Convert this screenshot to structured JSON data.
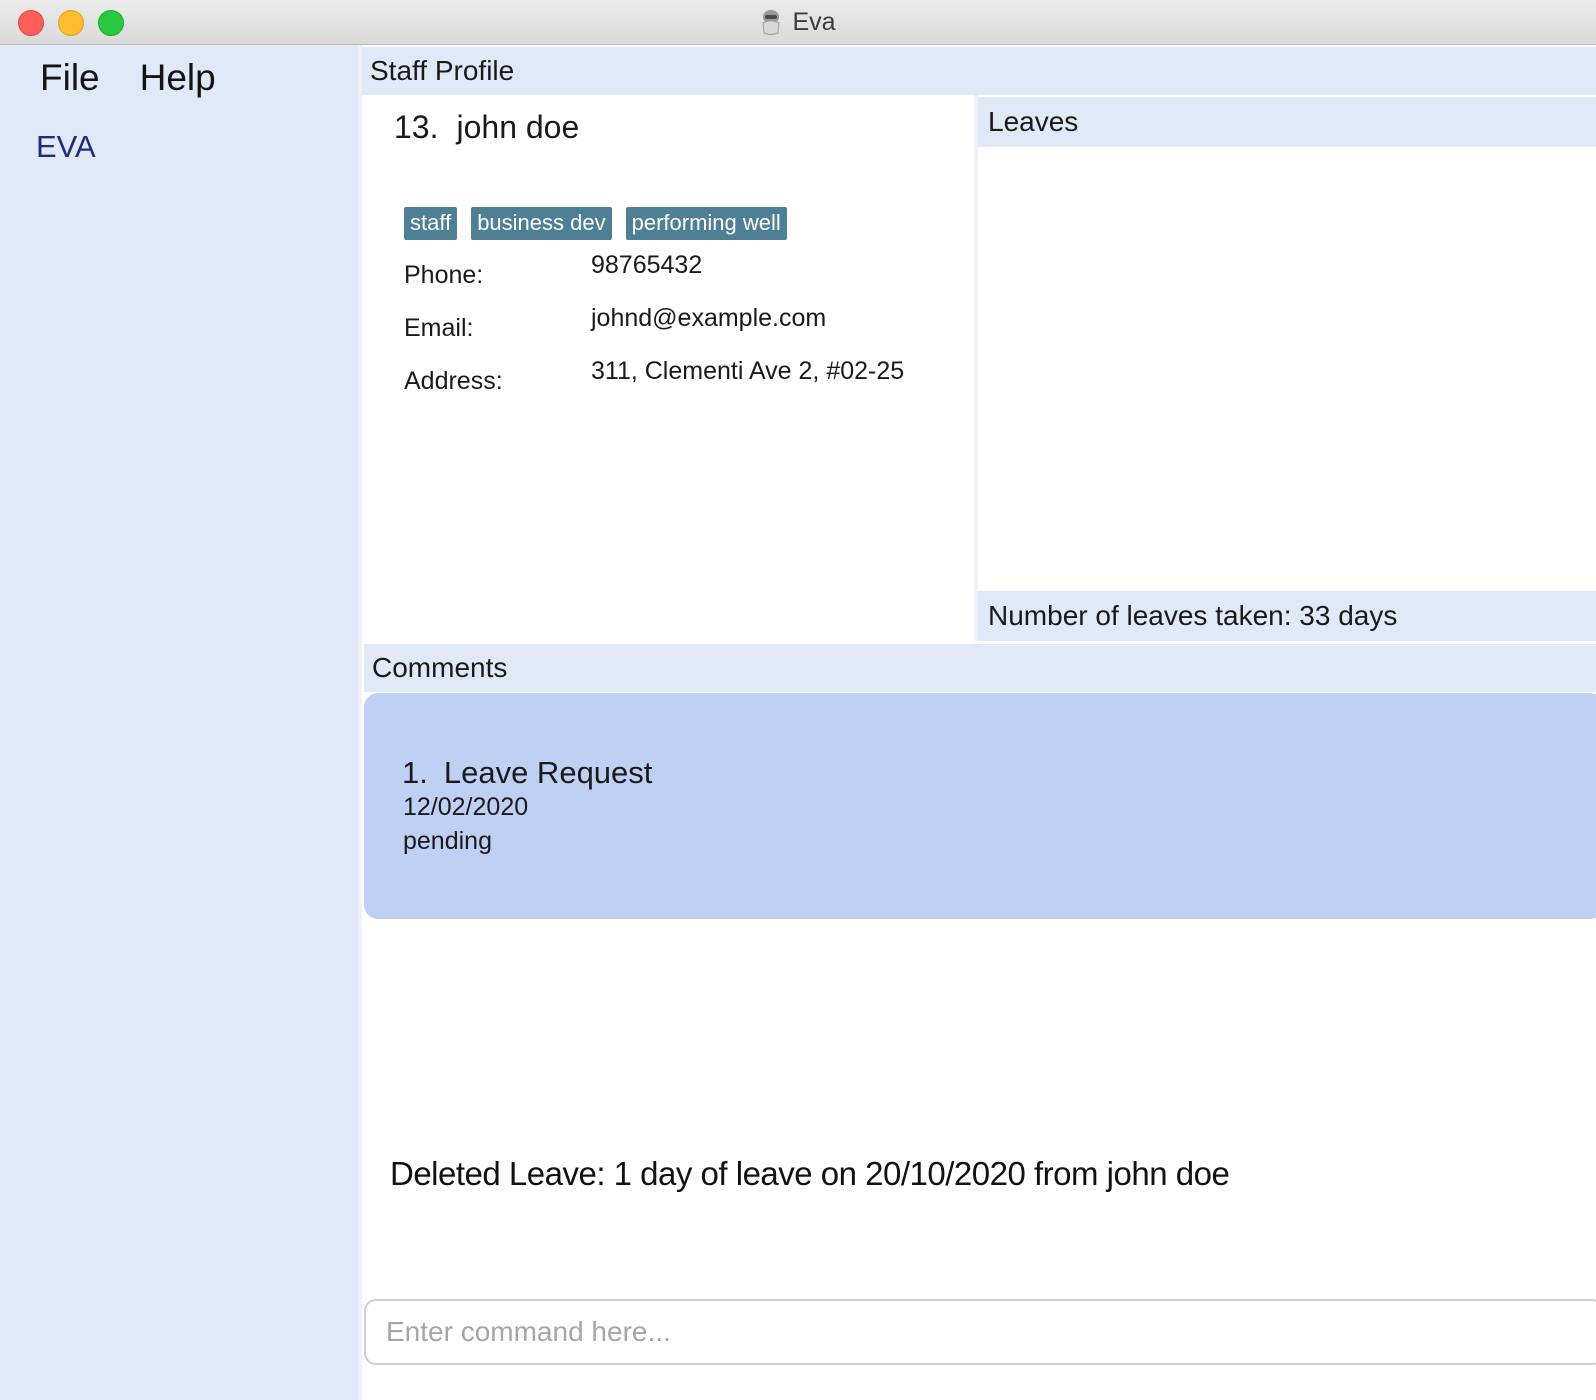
{
  "window": {
    "title": "Eva",
    "icon": "eva-robot-icon"
  },
  "menu": {
    "file": "File",
    "help": "Help"
  },
  "sidebar": {
    "brand": "EVA"
  },
  "staff_profile": {
    "header": "Staff Profile",
    "index": "13.",
    "name": "john doe",
    "tags": [
      "staff",
      "business dev",
      "performing well"
    ],
    "phone_label": "Phone:",
    "phone": "98765432",
    "email_label": "Email:",
    "email": "johnd@example.com",
    "address_label": "Address:",
    "address": "311, Clementi Ave 2, #02-25"
  },
  "leaves": {
    "header": "Leaves",
    "count_text": "Number of leaves taken: 33 days"
  },
  "comments": {
    "header": "Comments",
    "items": [
      {
        "index": "1.",
        "title": "Leave Request",
        "date": "12/02/2020",
        "status": "pending"
      }
    ]
  },
  "result": {
    "message": "Deleted Leave: 1 day of leave on 20/10/2020 from john doe"
  },
  "command": {
    "placeholder": "Enter command here...",
    "value": ""
  },
  "colors": {
    "panel_bg": "#e1e8f7",
    "tag_bg": "#4e7f94",
    "comment_card_bg": "#bfd0f5",
    "brand_text": "#1f2e7a"
  }
}
